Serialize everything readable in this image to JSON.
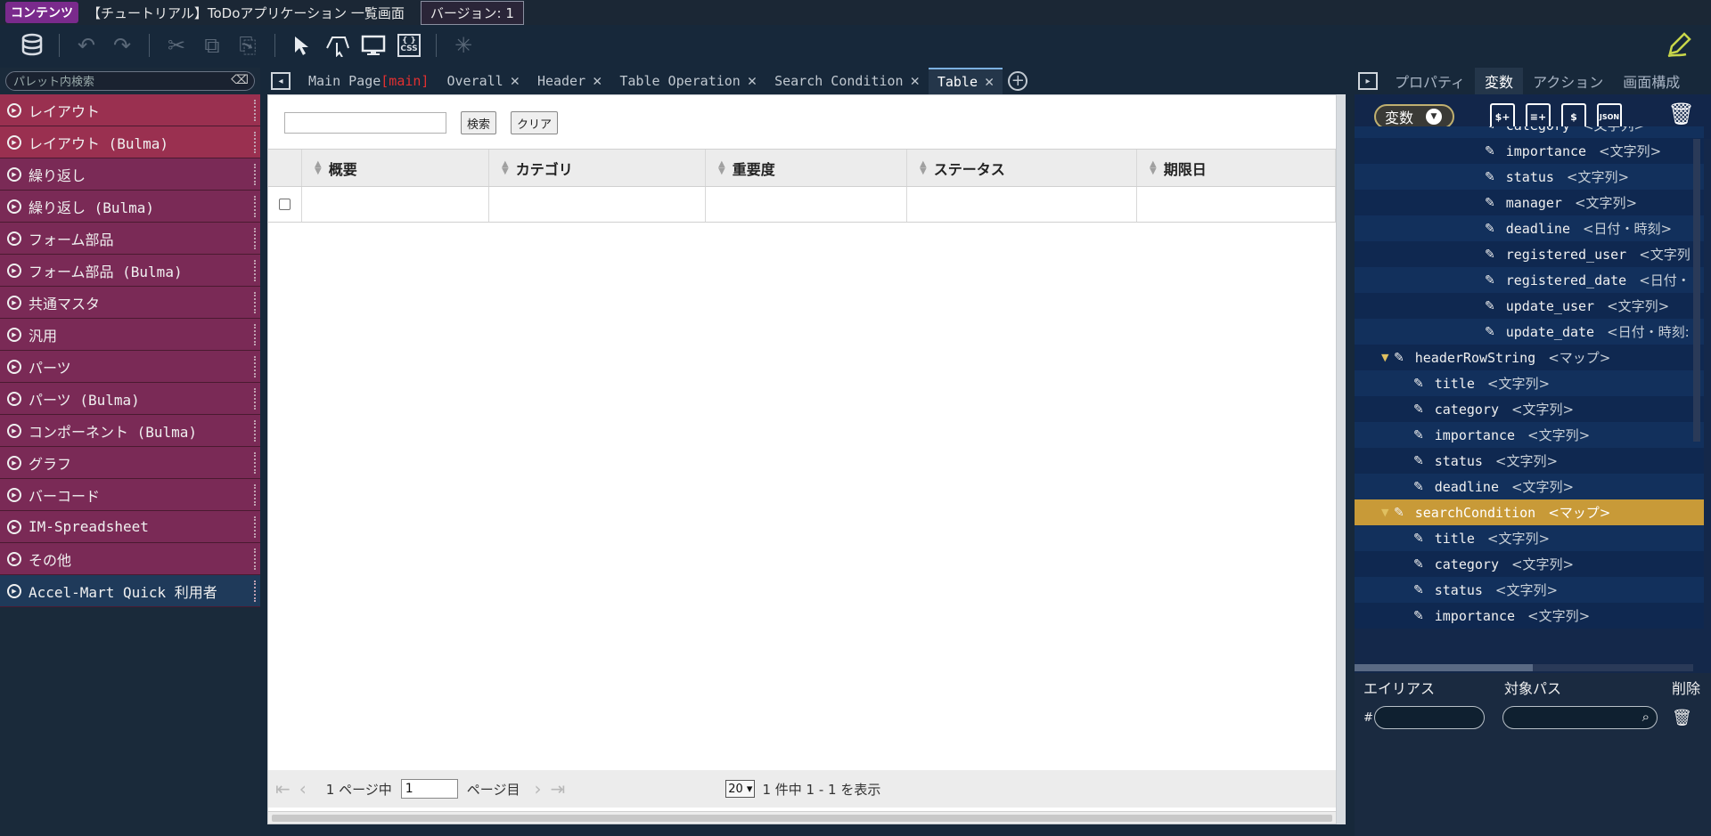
{
  "titlebar": {
    "badge": "コンテンツ",
    "title": "【チュートリアル】ToDoアプリケーション 一覧画面",
    "version": "バージョン: 1"
  },
  "toolbar": {
    "icons": [
      "database-icon",
      "undo-icon",
      "redo-icon",
      "cut-icon",
      "copy-icon",
      "paste-icon",
      "select-icon",
      "drag-icon",
      "preview-icon",
      "css-icon",
      "loading-icon",
      "edit-icon"
    ],
    "css_label_top": "{ }",
    "css_label_bottom": "CSS"
  },
  "palette": {
    "search_placeholder": "パレット内検索",
    "items": [
      {
        "label": "レイアウト",
        "style": "red"
      },
      {
        "label": "レイアウト (Bulma)",
        "style": "red"
      },
      {
        "label": "繰り返し",
        "style": "purple"
      },
      {
        "label": "繰り返し (Bulma)",
        "style": "purple"
      },
      {
        "label": "フォーム部品",
        "style": "purple"
      },
      {
        "label": "フォーム部品 (Bulma)",
        "style": "purple"
      },
      {
        "label": "共通マスタ",
        "style": "purple"
      },
      {
        "label": "汎用",
        "style": "purple"
      },
      {
        "label": "パーツ",
        "style": "purple"
      },
      {
        "label": "パーツ (Bulma)",
        "style": "purple"
      },
      {
        "label": "コンポーネント (Bulma)",
        "style": "purple"
      },
      {
        "label": "グラフ",
        "style": "purple"
      },
      {
        "label": "バーコード",
        "style": "purple"
      },
      {
        "label": "IM-Spreadsheet",
        "style": "purple"
      },
      {
        "label": "その他",
        "style": "purple"
      },
      {
        "label": "Accel-Mart Quick 利用者",
        "style": "blue"
      }
    ]
  },
  "tabs": [
    {
      "label": "Main Page",
      "suffix": "[main]",
      "closable": false,
      "active": false
    },
    {
      "label": "Overall",
      "suffix": "",
      "closable": true,
      "active": false
    },
    {
      "label": "Header",
      "suffix": "",
      "closable": true,
      "active": false
    },
    {
      "label": "Table Operation",
      "suffix": "",
      "closable": true,
      "active": false
    },
    {
      "label": "Search Condition",
      "suffix": "",
      "closable": true,
      "active": false
    },
    {
      "label": "Table",
      "suffix": "",
      "closable": true,
      "active": true
    }
  ],
  "canvas": {
    "search_button": "検索",
    "clear_button": "クリア",
    "columns": [
      "概要",
      "カテゴリ",
      "重要度",
      "ステータス",
      "期限日"
    ],
    "pager": {
      "total_pages": "1 ページ中",
      "current_page": "1",
      "page_suffix": "ページ目",
      "page_size": "20",
      "summary": "1 件中 1 - 1 を表示"
    }
  },
  "rpanel": {
    "tabs": [
      "プロパティ",
      "変数",
      "アクション",
      "画面構成"
    ],
    "active_tab": "変数",
    "var_select": "変数",
    "tool_icons": [
      "add-variable-icon",
      "add-db-icon",
      "copy-variable-icon",
      "json-icon"
    ],
    "json_label": "JSON",
    "tree": [
      {
        "indent": 2,
        "name": "category",
        "type": "<文字列>",
        "expandable": false,
        "selected": false
      },
      {
        "indent": 2,
        "name": "importance",
        "type": "<文字列>",
        "expandable": false,
        "selected": false
      },
      {
        "indent": 2,
        "name": "status",
        "type": "<文字列>",
        "expandable": false,
        "selected": false
      },
      {
        "indent": 2,
        "name": "manager",
        "type": "<文字列>",
        "expandable": false,
        "selected": false
      },
      {
        "indent": 2,
        "name": "deadline",
        "type": "<日付・時刻>",
        "expandable": false,
        "selected": false
      },
      {
        "indent": 2,
        "name": "registered_user",
        "type": "<文字列",
        "expandable": false,
        "selected": false
      },
      {
        "indent": 2,
        "name": "registered_date",
        "type": "<日付・",
        "expandable": false,
        "selected": false
      },
      {
        "indent": 2,
        "name": "update_user",
        "type": "<文字列>",
        "expandable": false,
        "selected": false
      },
      {
        "indent": 2,
        "name": "update_date",
        "type": "<日付・時刻:",
        "expandable": false,
        "selected": false
      },
      {
        "indent": 0,
        "name": "headerRowString",
        "type": "<マップ>",
        "expandable": true,
        "selected": false
      },
      {
        "indent": 1,
        "name": "title",
        "type": "<文字列>",
        "expandable": false,
        "selected": false
      },
      {
        "indent": 1,
        "name": "category",
        "type": "<文字列>",
        "expandable": false,
        "selected": false
      },
      {
        "indent": 1,
        "name": "importance",
        "type": "<文字列>",
        "expandable": false,
        "selected": false
      },
      {
        "indent": 1,
        "name": "status",
        "type": "<文字列>",
        "expandable": false,
        "selected": false
      },
      {
        "indent": 1,
        "name": "deadline",
        "type": "<文字列>",
        "expandable": false,
        "selected": false
      },
      {
        "indent": 0,
        "name": "searchCondition",
        "type": "<マップ>",
        "expandable": true,
        "selected": true
      },
      {
        "indent": 1,
        "name": "title",
        "type": "<文字列>",
        "expandable": false,
        "selected": false
      },
      {
        "indent": 1,
        "name": "category",
        "type": "<文字列>",
        "expandable": false,
        "selected": false
      },
      {
        "indent": 1,
        "name": "status",
        "type": "<文字列>",
        "expandable": false,
        "selected": false
      },
      {
        "indent": 1,
        "name": "importance",
        "type": "<文字列>",
        "expandable": false,
        "selected": false
      }
    ],
    "alias": {
      "col_alias": "エイリアス",
      "col_path": "対象パス",
      "col_delete": "削除",
      "hash": "#"
    }
  },
  "colors": {
    "selected_row": "#c89a38",
    "palette_red": "#9a3050",
    "palette_purple": "#7a2a56",
    "main_tag": "#e23030"
  }
}
